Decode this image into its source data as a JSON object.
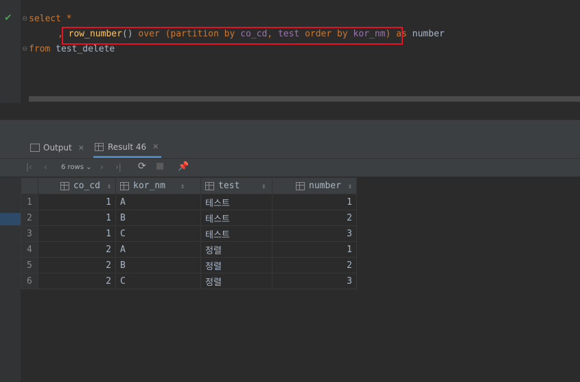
{
  "editor": {
    "line1": {
      "kw1": "select",
      "star": "*"
    },
    "line2": {
      "comma": ",",
      "fn": "row_number",
      "parens": "()",
      "over": "over",
      "open": "(",
      "partition": "partition by",
      "col1": "co_cd",
      "sep": ",",
      "col2": "test",
      "order": "order by",
      "col3": "kor_nm",
      "close": ")",
      "as": "as",
      "alias": "number"
    },
    "line3": {
      "from": "from",
      "table": "test_delete"
    }
  },
  "tabs": [
    {
      "label": "Output",
      "icon": "output-icon"
    },
    {
      "label": "Result 46",
      "icon": "table-icon"
    }
  ],
  "toolbar": {
    "rows_label": "6 rows"
  },
  "grid": {
    "columns": [
      "co_cd",
      "kor_nm",
      "test",
      "number"
    ],
    "rows": [
      {
        "n": "1",
        "co_cd": "1",
        "kor_nm": "A",
        "test": "테스트",
        "number": "1"
      },
      {
        "n": "2",
        "co_cd": "1",
        "kor_nm": "B",
        "test": "테스트",
        "number": "2"
      },
      {
        "n": "3",
        "co_cd": "1",
        "kor_nm": "C",
        "test": "테스트",
        "number": "3"
      },
      {
        "n": "4",
        "co_cd": "2",
        "kor_nm": "A",
        "test": "정렬",
        "number": "1"
      },
      {
        "n": "5",
        "co_cd": "2",
        "kor_nm": "B",
        "test": "정렬",
        "number": "2"
      },
      {
        "n": "6",
        "co_cd": "2",
        "kor_nm": "C",
        "test": "정렬",
        "number": "3"
      }
    ]
  },
  "colors": {
    "highlight_border": "#e81123",
    "keyword": "#cc7832",
    "function": "#ffc66d",
    "column": "#9876aa",
    "check": "#499c54"
  }
}
